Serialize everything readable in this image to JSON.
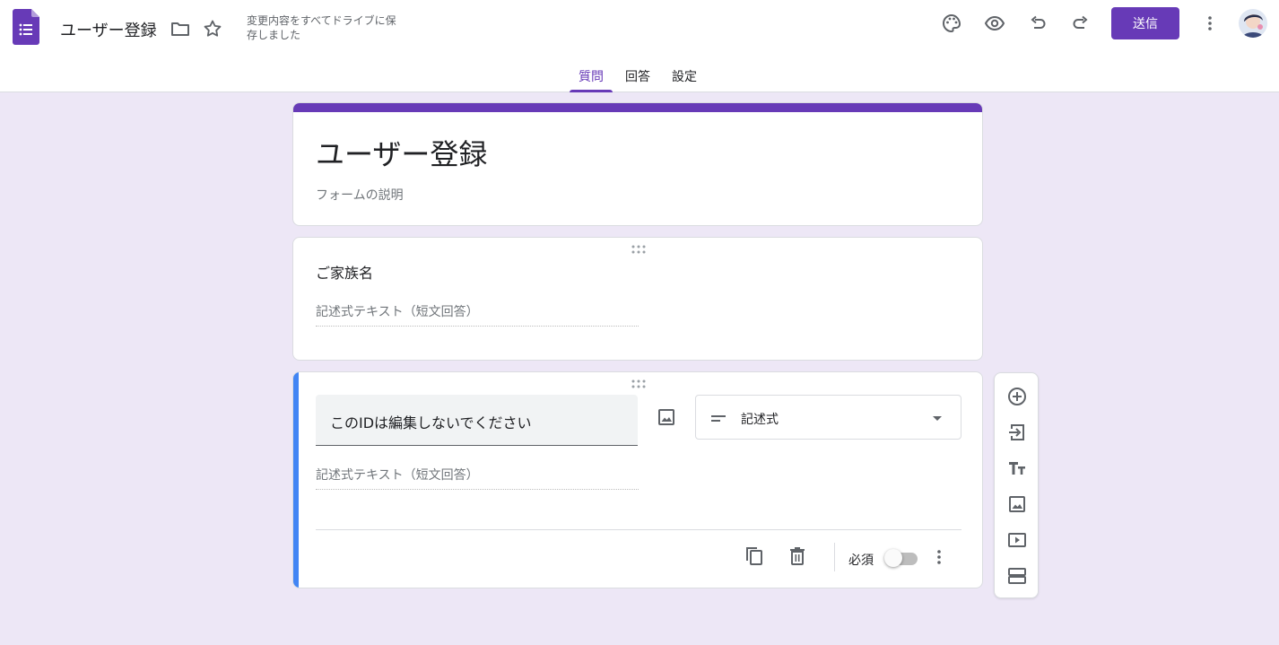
{
  "header": {
    "doc_title": "ユーザー登録",
    "save_status": "変更内容をすべてドライブに保存しました",
    "send_label": "送信",
    "icons": [
      "forms-app-icon",
      "folder-icon",
      "star-icon",
      "palette-icon",
      "preview-eye-icon",
      "undo-icon",
      "redo-icon",
      "more-vert-icon"
    ]
  },
  "tabs": [
    {
      "label": "質問",
      "active": true
    },
    {
      "label": "回答",
      "active": false
    },
    {
      "label": "設定",
      "active": false
    }
  ],
  "form": {
    "title": "ユーザー登録",
    "description_placeholder": "フォームの説明"
  },
  "questions": [
    {
      "title": "ご家族名",
      "answer_placeholder": "記述式テキスト（短文回答）"
    },
    {
      "title": "このIDは編集しないでください",
      "type": "記述式",
      "answer_placeholder": "記述式テキスト（短文回答）",
      "required_label": "必須",
      "required": false
    }
  ],
  "side_toolbar": {
    "icons": [
      "add-question-icon",
      "import-questions-icon",
      "add-title-icon",
      "add-image-icon",
      "add-video-icon",
      "add-section-icon"
    ]
  },
  "colors": {
    "accent": "#673ab7",
    "background": "#ede7f6",
    "active_question_bar": "#4285f4"
  }
}
